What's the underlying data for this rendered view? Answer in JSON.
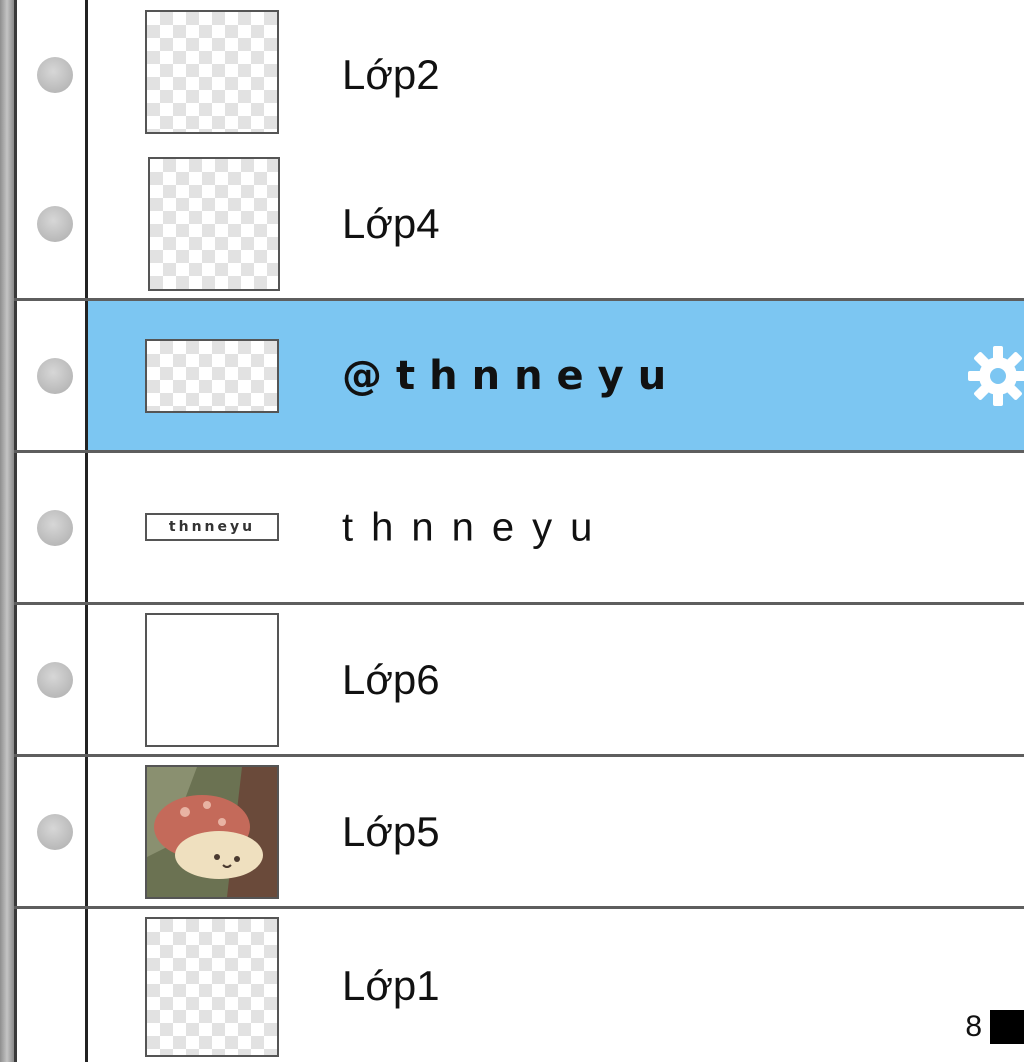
{
  "layers_panel": {
    "layers": [
      {
        "name": "Lớp2",
        "thumbnail": "transparent",
        "selected": false,
        "visibility_toggle": true
      },
      {
        "name": "Lớp4",
        "thumbnail": "transparent",
        "selected": false,
        "visibility_toggle": true
      },
      {
        "name": "@thnneyu",
        "thumbnail": "transparent",
        "selected": true,
        "visibility_toggle": true,
        "icon": "gear-icon"
      },
      {
        "name": "thnneyu",
        "thumbnail": "thnneyu",
        "selected": false,
        "visibility_toggle": true
      },
      {
        "name": "Lớp6",
        "thumbnail": "white",
        "selected": false,
        "visibility_toggle": true
      },
      {
        "name": "Lớp5",
        "thumbnail": "mushroom-artwork",
        "selected": false,
        "visibility_toggle": true
      },
      {
        "name": "Lớp1",
        "thumbnail": "transparent",
        "selected": false,
        "visibility_toggle": false
      }
    ],
    "footer": {
      "number": "8",
      "swatch_color": "#000000"
    },
    "colors": {
      "selected_row": "#7cc6f2",
      "divider": "#5e5e5e",
      "gear_icon": "#ffffff"
    }
  }
}
